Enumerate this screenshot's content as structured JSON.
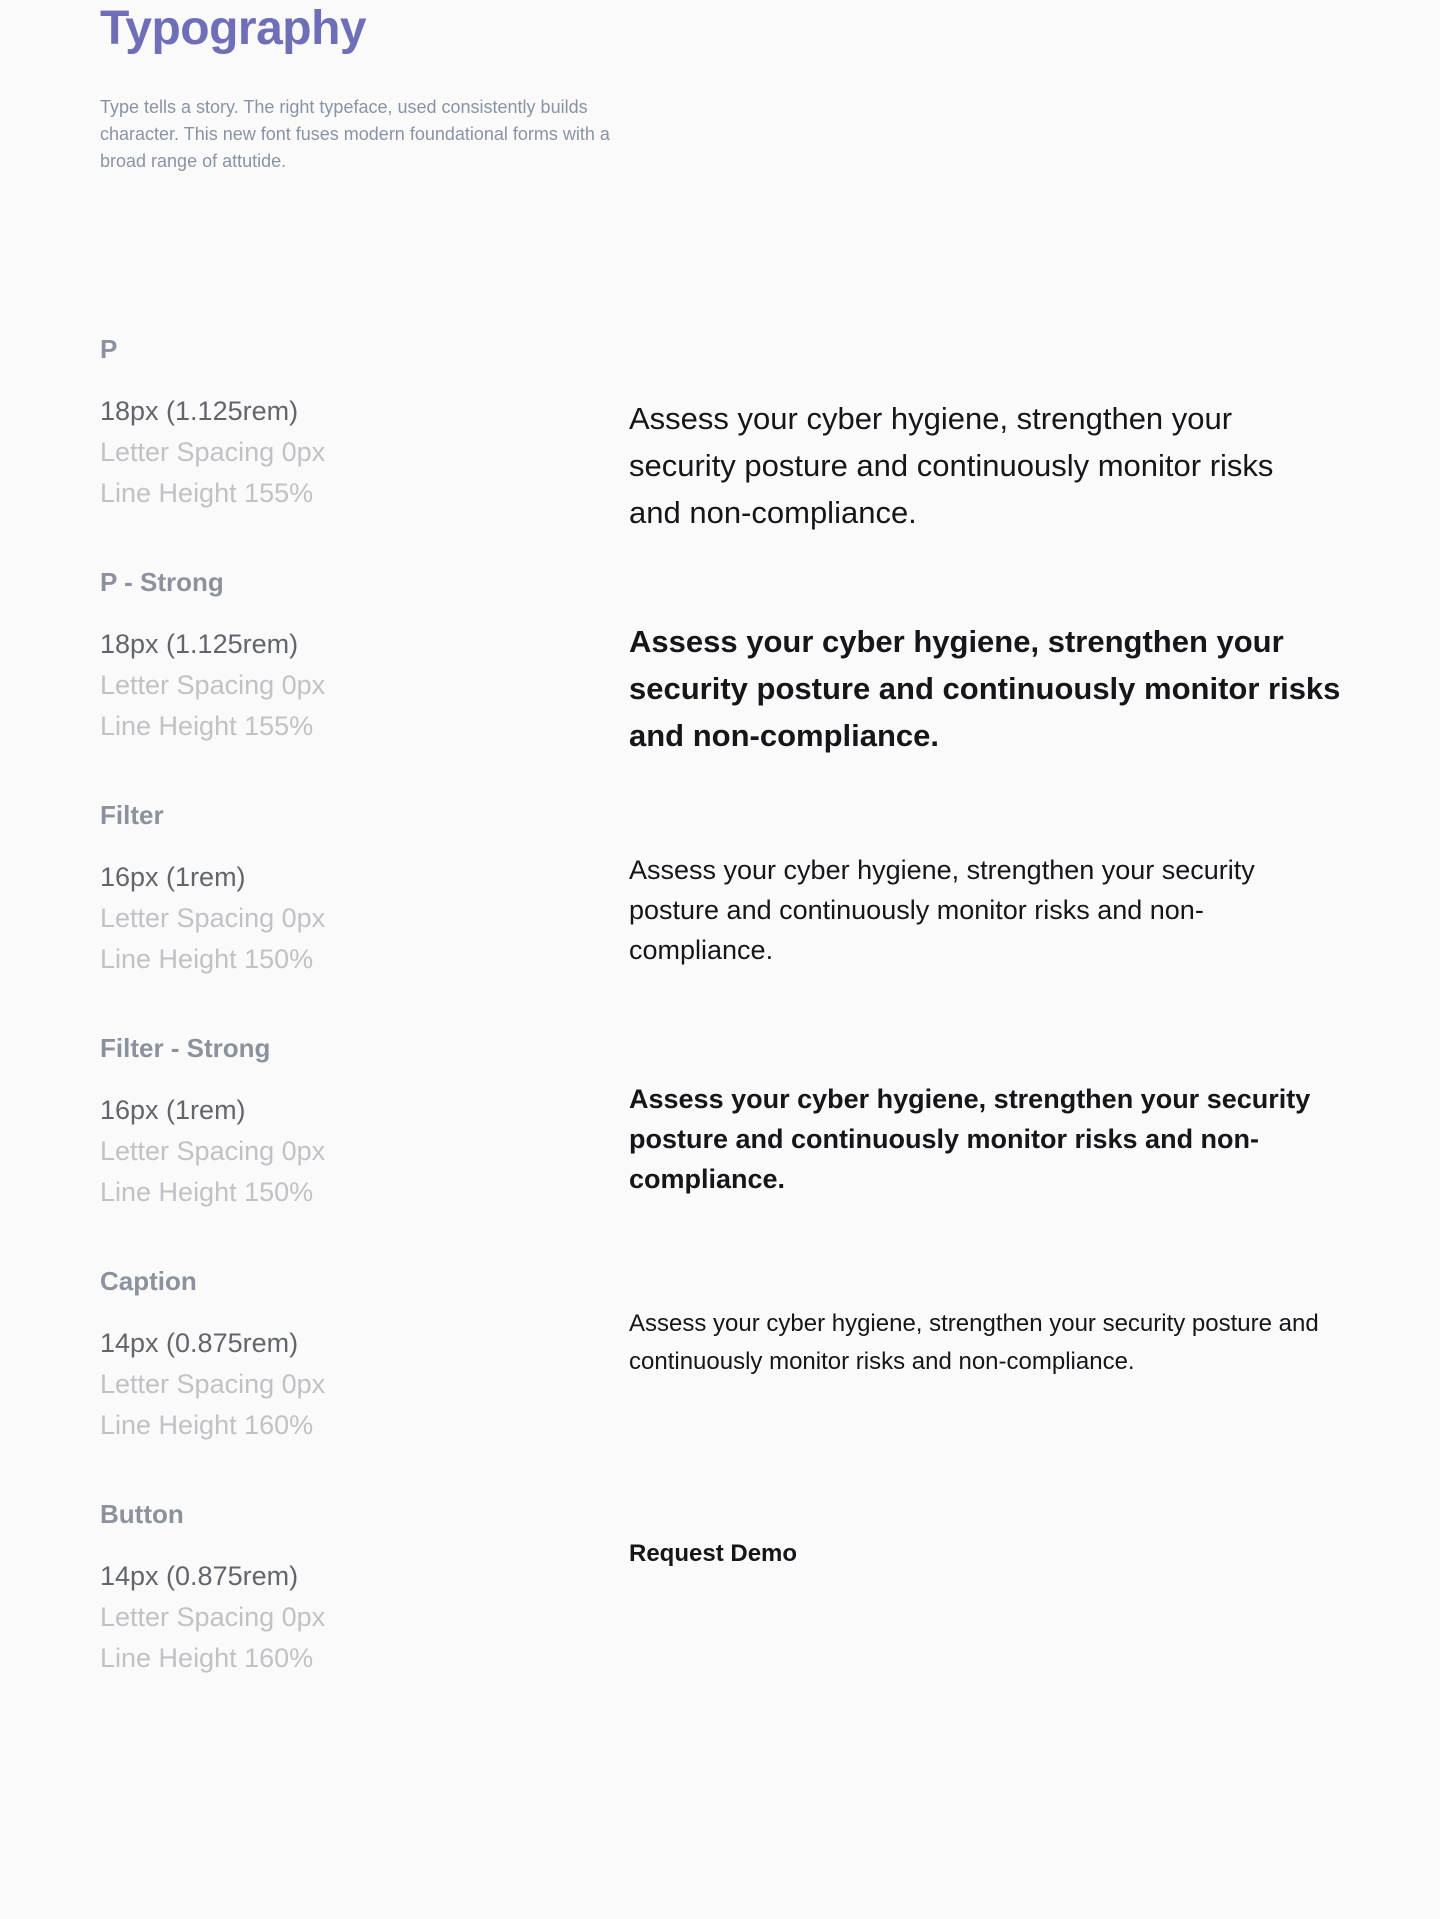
{
  "header": {
    "title": "Typography",
    "description": "Type tells a story. The right typeface, used consistently builds character. This new font fuses modern foundational forms with a broad range of attutide."
  },
  "styles": [
    {
      "name": "P",
      "size": "18px (1.125rem)",
      "letter_spacing": "Letter Spacing 0px",
      "line_height": "Line Height 155%",
      "sample": "Assess your cyber hygiene, strengthen your security posture and continuously monitor risks and non-compliance."
    },
    {
      "name": "P - Strong",
      "size": "18px (1.125rem)",
      "letter_spacing": "Letter Spacing 0px",
      "line_height": "Line Height 155%",
      "sample": "Assess your cyber hygiene, strengthen your security posture and continuously monitor risks and non-compliance."
    },
    {
      "name": "Filter",
      "size": "16px (1rem)",
      "letter_spacing": "Letter Spacing 0px",
      "line_height": "Line Height 150%",
      "sample": "Assess your cyber hygiene, strengthen your security posture and continuously monitor risks and non-compliance."
    },
    {
      "name": "Filter - Strong",
      "size": "16px (1rem)",
      "letter_spacing": "Letter Spacing 0px",
      "line_height": "Line Height 150%",
      "sample": "Assess your cyber hygiene, strengthen your security posture and continuously monitor risks and non-compliance."
    },
    {
      "name": "Caption",
      "size": "14px (0.875rem)",
      "letter_spacing": "Letter Spacing 0px",
      "line_height": "Line Height 160%",
      "sample": "Assess your cyber hygiene, strengthen your security posture and continuously monitor risks and non-compliance."
    },
    {
      "name": "Button",
      "size": "14px (0.875rem)",
      "letter_spacing": "Letter Spacing 0px",
      "line_height": "Line Height 160%",
      "sample": "Request Demo"
    }
  ],
  "colors": {
    "title": "#6f6fb8",
    "description": "#8a93a5",
    "style_name": "#8c929d",
    "spec_primary": "#62656b",
    "spec_secondary": "#c0c2c6",
    "sample_text": "#14161a",
    "background": "#fafafa"
  }
}
